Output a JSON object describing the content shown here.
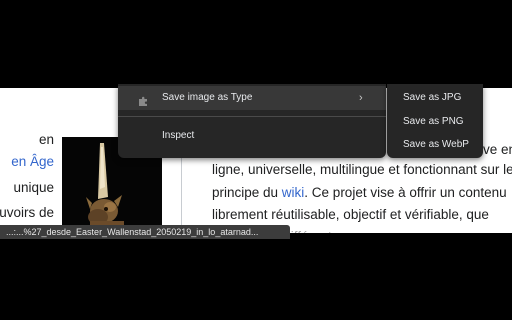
{
  "left_column": {
    "line1": "en",
    "line2_link": "en Âge",
    "line3": "unique",
    "line4": "uvoirs de"
  },
  "right_column": {
    "line1_visible": "ive en",
    "line2": "ligne, universelle, multilingue et fonctionnant sur le",
    "line3_before": "principe du ",
    "line3_link": "wiki",
    "line3_after": ". Ce projet vise à offrir un contenu",
    "line4": "librement réutilisable, objectif et vérifiable, que",
    "line5": "...différents..."
  },
  "status_bar": {
    "url": "...:...%27_desde_Easter_Wallenstad_2050219_in_lo_atarnad..."
  },
  "context_menu": {
    "items": [
      {
        "label": "Save image as Type",
        "icon": "puzzle-extension-icon",
        "has_submenu": true
      },
      {
        "label": "Inspect"
      }
    ]
  },
  "submenu": {
    "items": [
      {
        "label": "Save as JPG"
      },
      {
        "label": "Save as PNG"
      },
      {
        "label": "Save as WebP"
      }
    ]
  },
  "colors": {
    "menu_bg": "#262626",
    "menu_highlight": "#383838",
    "menu_text": "#e8eaed",
    "link": "#3366cc",
    "body_text": "#202122"
  }
}
